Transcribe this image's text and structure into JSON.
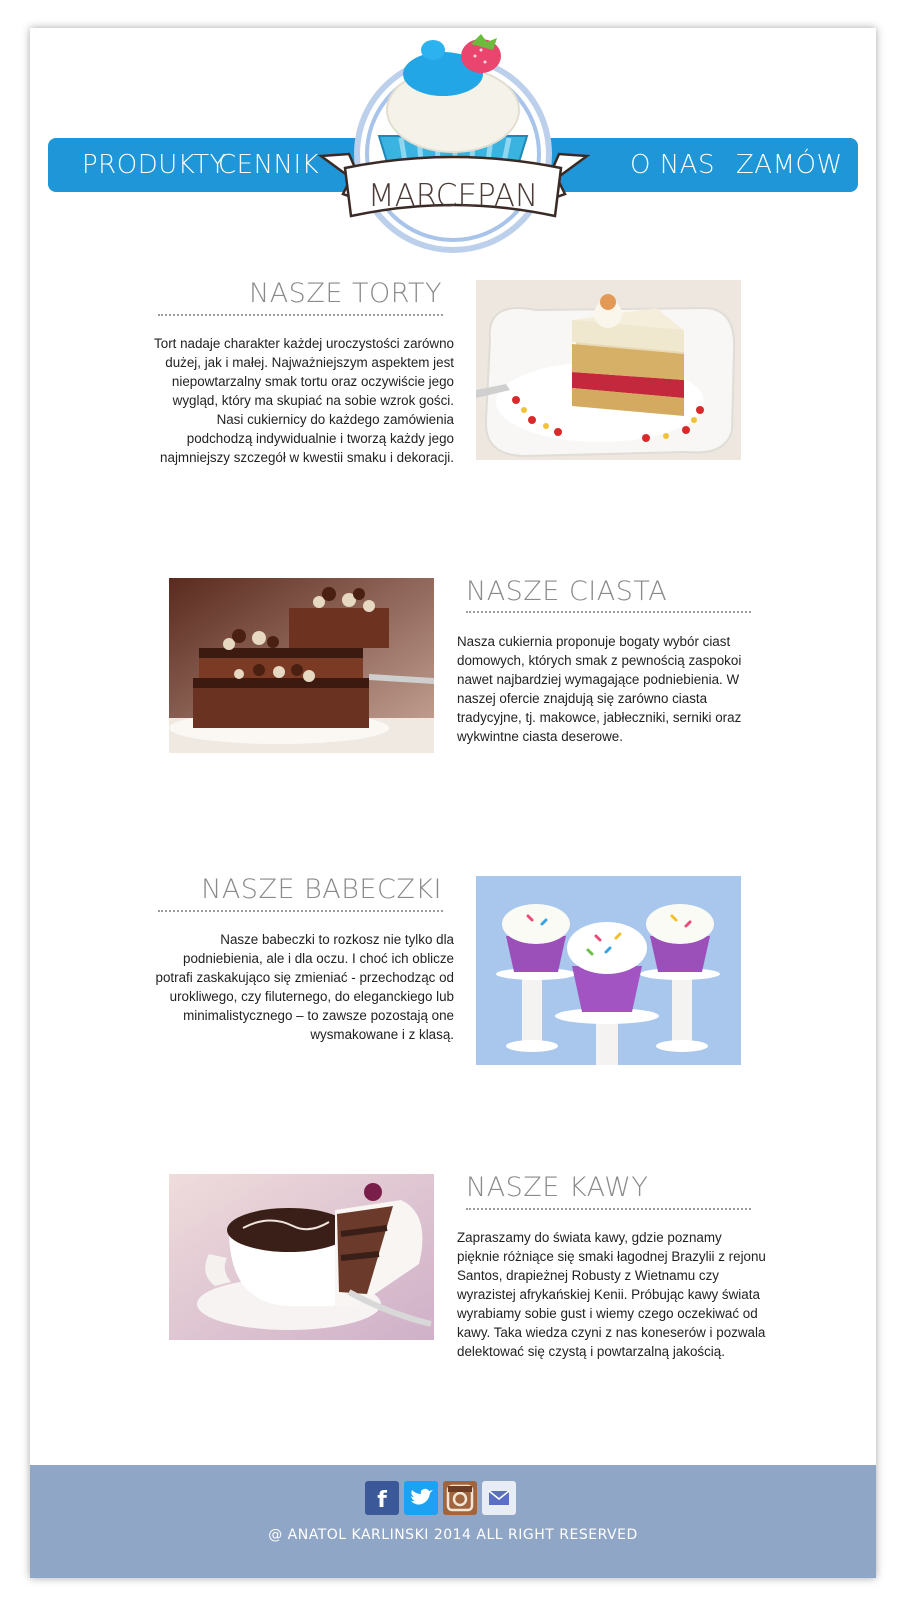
{
  "nav": {
    "items": [
      {
        "label": "PRODUKTY"
      },
      {
        "label": "CENNIK"
      },
      {
        "label": "O NAS"
      },
      {
        "label": "ZAMÓW"
      }
    ]
  },
  "logo": {
    "text": "MARCEPAN"
  },
  "sections": [
    {
      "title": "NASZE TORTY",
      "text": "Tort nadaje charakter każdej uroczystości zarówno dużej, jak i małej. Najważniejszym aspektem jest niepowtarzalny smak tortu oraz oczywiście jego wygląd, który ma skupiać na sobie wzrok gości. Nasi cukiernicy do każdego zamówienia podchodzą indywidualnie i tworzą każdy jego najmniejszy szczegół w kwestii smaku i dekoracji."
    },
    {
      "title": "NASZE CIASTA",
      "text": "Nasza cukiernia proponuje bogaty wybór ciast domowych, których smak z pewnością zaspokoi nawet najbardziej wymagające podniebienia. W naszej ofercie znajdują się zarówno ciasta tradycyjne, tj. makowce, jabłeczniki, serniki oraz wykwintne ciasta deserowe."
    },
    {
      "title": "NASZE BABECZKI",
      "text": "Nasze babeczki to rozkosz nie tylko dla podniebienia, ale i dla oczu. I choć ich oblicze potrafi zaskakująco się zmieniać - przechodząc od urokliwego, czy filuternego, do eleganckiego lub minimalistycznego – to zawsze pozostają one wysmakowane i z klasą."
    },
    {
      "title": "NASZE KAWY",
      "text": "Zapraszamy do świata kawy, gdzie poznamy pięknie różniące się smaki łagodnej Brazylii z rejonu Santos, drapieżnej Robusty z Wietnamu czy wyrazistej afrykańskiej Kenii. Próbując kawy świata wyrabiamy sobie gust i wiemy czego oczekiwać od kawy. Taka wiedza czyni z nas koneserów i pozwala delektować się czystą i powtarzalną jakością."
    }
  ],
  "footer": {
    "social": [
      {
        "icon": "facebook-icon",
        "glyph": "f",
        "color": "#3b5998"
      },
      {
        "icon": "twitter-icon",
        "glyph": "t",
        "color": "#1da1f2"
      },
      {
        "icon": "instagram-icon",
        "glyph": "◎",
        "color": "#a0643f"
      },
      {
        "icon": "mail-icon",
        "glyph": "✉",
        "color": "#e8edf5"
      }
    ],
    "copyright": "@ ANATOL KARLINSKI 2014 ALL RIGHT RESERVED"
  },
  "colors": {
    "nav": "#1e96d8",
    "footer": "#8fa6c6",
    "accent": "#29a3e0"
  }
}
